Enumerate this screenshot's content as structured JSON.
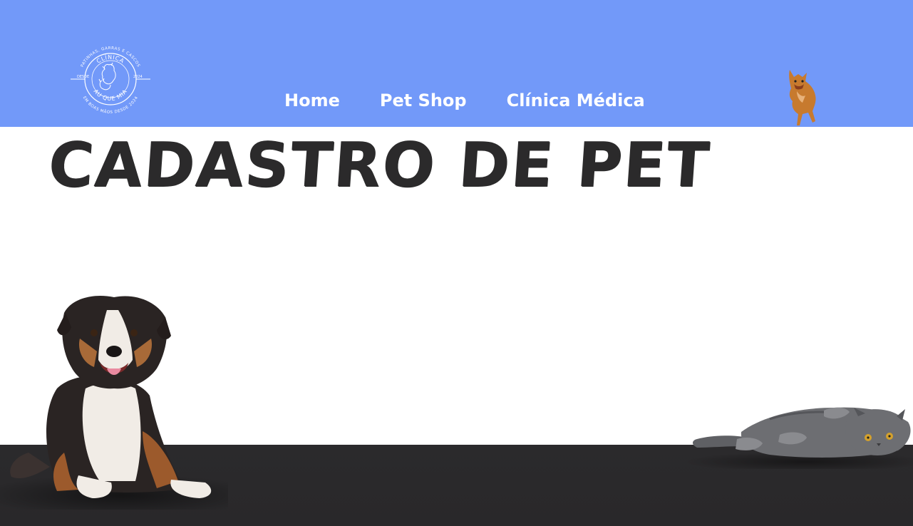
{
  "header": {
    "logo": {
      "ring_top_text": "PATINHAS, GARRAS E CASCOS",
      "title_top": "CLÍNICA",
      "title_bottom": "AU QUE MIA",
      "left_tag": "DESDE",
      "right_tag": "2024",
      "ring_bottom_text": "EM BOAS MÃOS DESDE 2024"
    },
    "nav": [
      {
        "label": "Home"
      },
      {
        "label": "Pet Shop"
      },
      {
        "label": "Clínica Médica"
      }
    ]
  },
  "main": {
    "title": "CADASTRO DE PET"
  },
  "colors": {
    "header_bg": "#7299f9",
    "title_text": "#2b2a2b",
    "floor": "#2b2a2c",
    "nav_text": "#ffffff"
  },
  "icons": {
    "logo": "clinic-logo-icon",
    "running_dog": "running-dog-icon",
    "dog": "sitting-dog-icon",
    "cat": "lying-cat-icon"
  }
}
